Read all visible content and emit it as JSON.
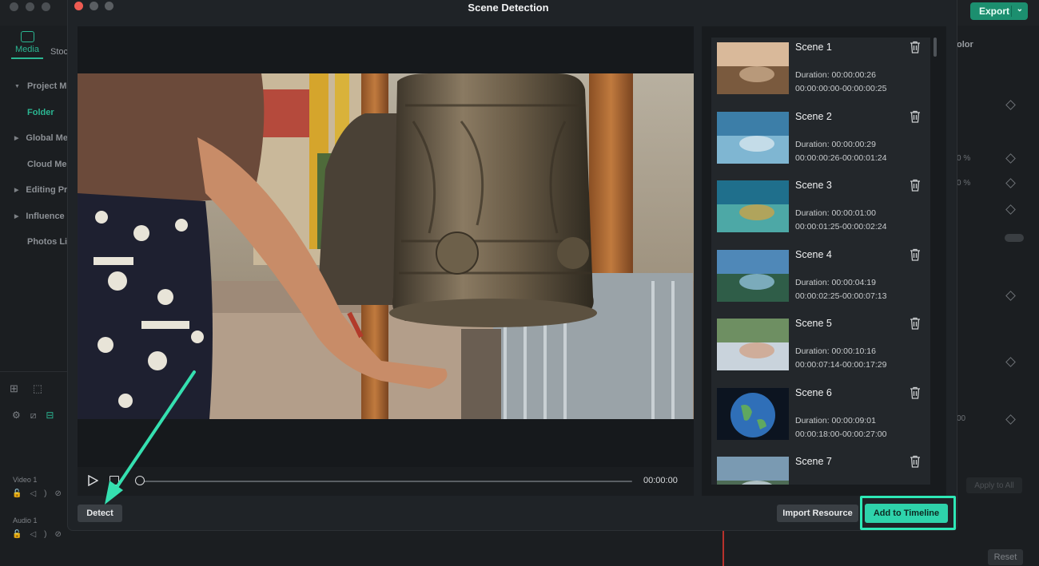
{
  "background_app": {
    "export_label": "Export",
    "tabs": [
      "Media",
      "Stock"
    ],
    "tree": [
      {
        "label": "Project Me",
        "arrow": true
      },
      {
        "label": "Folder",
        "arrow": false,
        "active": true
      },
      {
        "label": "Global Me",
        "arrow": true
      },
      {
        "label": "Cloud Med",
        "arrow": false
      },
      {
        "label": "Editing Pr",
        "arrow": true
      },
      {
        "label": "Influence I",
        "arrow": true
      },
      {
        "label": "Photos Lib",
        "arrow": false
      }
    ],
    "right_tab": "olor",
    "tracks": [
      "Video 1",
      "Audio 1"
    ],
    "apply_all_label": "Apply to All",
    "reset_label": "Reset",
    "percent_suffix": "0 %",
    "value_00": "00"
  },
  "modal": {
    "title": "Scene Detection",
    "time_display": "00:00:00",
    "detect_label": "Detect",
    "import_label": "Import Resource",
    "add_label": "Add to Timeline"
  },
  "scenes": [
    {
      "name": "Scene 1",
      "duration": "Duration: 00:00:00:26",
      "range": "00:00:00:00-00:00:00:25"
    },
    {
      "name": "Scene 2",
      "duration": "Duration: 00:00:00:29",
      "range": "00:00:00:26-00:00:01:24"
    },
    {
      "name": "Scene 3",
      "duration": "Duration: 00:00:01:00",
      "range": "00:00:01:25-00:00:02:24"
    },
    {
      "name": "Scene 4",
      "duration": "Duration: 00:00:04:19",
      "range": "00:00:02:25-00:00:07:13"
    },
    {
      "name": "Scene 5",
      "duration": "Duration: 00:00:10:16",
      "range": "00:00:07:14-00:00:17:29"
    },
    {
      "name": "Scene 6",
      "duration": "Duration: 00:00:09:01",
      "range": "00:00:18:00-00:00:27:00"
    },
    {
      "name": "Scene 7",
      "duration": "",
      "range": ""
    }
  ],
  "colors": {
    "accent": "#2ed3ab",
    "highlight": "#2ee8b6",
    "close": "#ee5b52"
  }
}
